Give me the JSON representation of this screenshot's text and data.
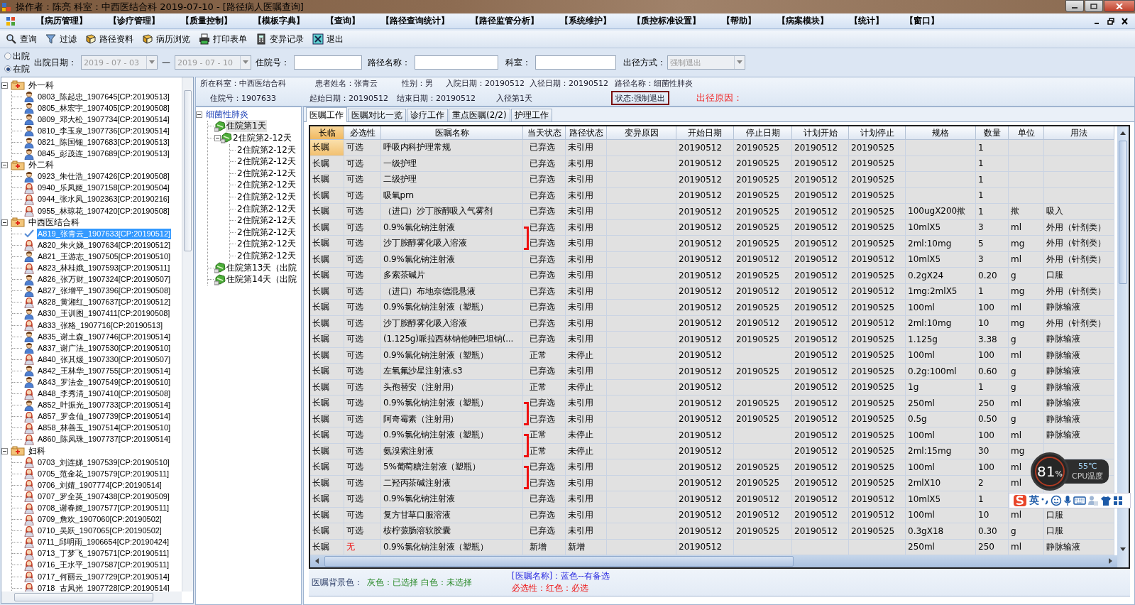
{
  "window": {
    "title": "操作者：陈亮  科室：中西医结合科  2019-07-10 - [路径病人医嘱查询]"
  },
  "menu": [
    "【病历管理】",
    "【诊疗管理】",
    "【质量控制】",
    "【模板字典】",
    "【查询】",
    "【路径查询统计】",
    "【路径监管分析】",
    "【系统维护】",
    "【质控标准设置】",
    "【帮助】",
    "【病案模块】",
    "【统计】",
    "【窗口】"
  ],
  "toolbar": [
    {
      "label": "查询",
      "kind": "search"
    },
    {
      "label": "过滤",
      "kind": "filter"
    },
    {
      "label": "路径资料",
      "kind": "book"
    },
    {
      "label": "病历浏览",
      "kind": "book"
    },
    {
      "label": "打印表单",
      "kind": "print"
    },
    {
      "label": "变异记录",
      "kind": "calc"
    },
    {
      "label": "退出",
      "kind": "exit"
    }
  ],
  "filter": {
    "status_options": [
      {
        "label": "出院",
        "selected": false
      },
      {
        "label": "在院",
        "selected": true
      }
    ],
    "discharge_date": {
      "label": "出院日期：",
      "from": "2019 - 07 - 03",
      "separator": "—",
      "to": "2019 - 07 - 10",
      "disabled": true
    },
    "inputs": [
      {
        "label": "住院号："
      },
      {
        "label": "路径名称："
      },
      {
        "label": "科室："
      }
    ],
    "exit_mode": {
      "label": "出径方式：",
      "value": "强制退出",
      "disabled": true
    }
  },
  "patient_tree": [
    {
      "label": "外一科",
      "expanded": true,
      "children": [
        {
          "label": "0803_陈起忠_1907645[CP:20190513]",
          "kind": "male",
          "selected": false
        },
        {
          "label": "0805_林宏宇_1907405[CP:20190508]",
          "kind": "male",
          "selected": false
        },
        {
          "label": "0809_邓大松_1907734[CP:20190514]",
          "kind": "male",
          "selected": false
        },
        {
          "label": "0810_李玉泉_1907736[CP:20190514]",
          "kind": "male",
          "selected": false
        },
        {
          "label": "0821_陈国钿_1907683[CP:20190513]",
          "kind": "male",
          "selected": false
        },
        {
          "label": "0845_彭茂连_1907689[CP:20190513]",
          "kind": "male",
          "selected": false
        }
      ]
    },
    {
      "label": "外二科",
      "expanded": true,
      "children": [
        {
          "label": "0923_朱仕浩_1907426[CP:20190508]",
          "kind": "male",
          "selected": false
        },
        {
          "label": "0940_乐凤姬_1907158[CP:20190504]",
          "kind": "female",
          "selected": false
        },
        {
          "label": "0944_张水凤_1902363[CP:20190216]",
          "kind": "female",
          "selected": false
        },
        {
          "label": "0955_林琼花_1907420[CP:20190508]",
          "kind": "female",
          "selected": false
        }
      ]
    },
    {
      "label": "中西医结合科",
      "expanded": true,
      "children": [
        {
          "label": "A819_张青云_1907633[CP:20190512]",
          "kind": "check",
          "selected": true
        },
        {
          "label": "A820_朱火娣_1907634[CP:20190512]",
          "kind": "female",
          "selected": false
        },
        {
          "label": "A821_王游志_1907505[CP:20190510]",
          "kind": "male",
          "selected": false
        },
        {
          "label": "A823_林桂娥_1907593[CP:20190511]",
          "kind": "female",
          "selected": false
        },
        {
          "label": "A826_张万财_1907324[CP:20190507]",
          "kind": "male",
          "selected": false
        },
        {
          "label": "A827_张增平_1907396[CP:20190508]",
          "kind": "male",
          "selected": false
        },
        {
          "label": "A828_黄湘红_1907637[CP:20190512]",
          "kind": "female",
          "selected": false
        },
        {
          "label": "A830_王训图_1907411[CP:20190508]",
          "kind": "male",
          "selected": false
        },
        {
          "label": "A833_张格_1907716[CP:20190513]",
          "kind": "female",
          "selected": false
        },
        {
          "label": "A835_谢土森_1907746[CP:20190514]",
          "kind": "male",
          "selected": false
        },
        {
          "label": "A837_谢广法_1907530[CP:20190510]",
          "kind": "male",
          "selected": false
        },
        {
          "label": "A840_张其煖_1907330[CP:20190507]",
          "kind": "female",
          "selected": false
        },
        {
          "label": "A842_王林华_1907755[CP:20190514]",
          "kind": "male",
          "selected": false
        },
        {
          "label": "A843_罗法金_1907549[CP:20190510]",
          "kind": "male",
          "selected": false
        },
        {
          "label": "A848_李秀清_1907410[CP:20190508]",
          "kind": "female",
          "selected": false
        },
        {
          "label": "A852_叶振光_1907733[CP:20190514]",
          "kind": "male",
          "selected": false
        },
        {
          "label": "A857_罗金仙_1907739[CP:20190514]",
          "kind": "female",
          "selected": false
        },
        {
          "label": "A858_林善玉_1907514[CP:20190510]",
          "kind": "female",
          "selected": false
        },
        {
          "label": "A860_陈凤珠_1907737[CP:20190514]",
          "kind": "female",
          "selected": false
        }
      ]
    },
    {
      "label": "妇科",
      "expanded": true,
      "children": [
        {
          "label": "0703_刘连娣_1907539[CP:20190510]",
          "kind": "female",
          "selected": false
        },
        {
          "label": "0705_范金花_1907579[CP:20190511]",
          "kind": "female",
          "selected": false
        },
        {
          "label": "0706_刘婧_1907774[CP:20190514]",
          "kind": "female",
          "selected": false
        },
        {
          "label": "0707_罗全英_1907438[CP:20190509]",
          "kind": "female",
          "selected": false
        },
        {
          "label": "0708_谢春姬_1907577[CP:20190511]",
          "kind": "female",
          "selected": false
        },
        {
          "label": "0709_詹欢_1907060[CP:20190502]",
          "kind": "female",
          "selected": false
        },
        {
          "label": "0710_吴跃_1907065[CP:20190502]",
          "kind": "female",
          "selected": false
        },
        {
          "label": "0711_邱明雨_1906654[CP:20190424]",
          "kind": "female",
          "selected": false
        },
        {
          "label": "0713_丁梦飞_1907571[CP:20190511]",
          "kind": "female",
          "selected": false
        },
        {
          "label": "0716_王水平_1907587[CP:20190511]",
          "kind": "female",
          "selected": false
        },
        {
          "label": "0717_何丽云_1907729[CP:20190514]",
          "kind": "female",
          "selected": false
        },
        {
          "label": "0718_古凤光_1907728[CP:20190514]",
          "kind": "female",
          "selected": false
        }
      ]
    }
  ],
  "info": {
    "rows": [
      [
        "所在科室：中西医结合科",
        "患者姓名：张青云",
        "性别：男",
        "入院日期：20190512",
        "入径日期：20190512",
        "路径名称：细菌性肺炎"
      ],
      [
        "住院号：1907633",
        "起始日期：20190512",
        "结束日期：20190512",
        "入径第1天"
      ]
    ],
    "status": "状态:强制退出",
    "exit_reason_label": "出径原因："
  },
  "path_tree": {
    "label": "细菌性肺炎",
    "expanded": true,
    "selected": false,
    "children": [
      {
        "label": "住院第1天",
        "selected": true
      },
      {
        "label": "2住院第2-12天",
        "expanded": true,
        "selected": false,
        "children": [
          {
            "label": "2住院第2-12天",
            "selected": false
          },
          {
            "label": "2住院第2-12天",
            "selected": false
          },
          {
            "label": "2住院第2-12天",
            "selected": false
          },
          {
            "label": "2住院第2-12天",
            "selected": false
          },
          {
            "label": "2住院第2-12天",
            "selected": false
          },
          {
            "label": "2住院第2-12天",
            "selected": false
          },
          {
            "label": "2住院第2-12天",
            "selected": false
          },
          {
            "label": "2住院第2-12天",
            "selected": false
          },
          {
            "label": "2住院第2-12天",
            "selected": false
          },
          {
            "label": "2住院第2-12天",
            "selected": false
          }
        ]
      },
      {
        "label": "住院第13天（出院",
        "selected": false
      },
      {
        "label": "住院第14天（出院",
        "selected": false
      }
    ]
  },
  "tabs": [
    {
      "label": "医嘱工作",
      "selected": true
    },
    {
      "label": "医嘱对比一览",
      "selected": false
    },
    {
      "label": "诊疗工作",
      "selected": false
    },
    {
      "label": "重点医嘱(2/2)",
      "selected": false
    },
    {
      "label": "护理工作",
      "selected": false
    }
  ],
  "table": {
    "columns": [
      "长临",
      "必选性",
      "医嘱名称",
      "当天状态",
      "路径状态",
      "变异原因",
      "开始日期",
      "停止日期",
      "计划开始",
      "计划停止",
      "规格",
      "数量",
      "单位",
      "用法"
    ],
    "rows": [
      {
        "order_type": "长嘱",
        "required": "可选",
        "name": "呼吸内科护理常规",
        "day_status": "已弃选",
        "path_status": "未引用",
        "start_date": "20190512",
        "stop_date": "20190525",
        "plan_start": "20190512",
        "plan_stop": "20190525",
        "quantity": "1",
        "selected": true,
        "mandatory": false,
        "chosen": true,
        "bracket": false
      },
      {
        "order_type": "长嘱",
        "required": "可选",
        "name": "一级护理",
        "day_status": "已弃选",
        "path_status": "未引用",
        "start_date": "20190512",
        "stop_date": "20190525",
        "plan_start": "20190512",
        "plan_stop": "20190525",
        "quantity": "1",
        "selected": false,
        "mandatory": false,
        "chosen": true,
        "bracket": false
      },
      {
        "order_type": "长嘱",
        "required": "可选",
        "name": "二级护理",
        "day_status": "已弃选",
        "path_status": "未引用",
        "start_date": "20190512",
        "stop_date": "20190525",
        "plan_start": "20190512",
        "plan_stop": "20190525",
        "quantity": "1",
        "selected": false,
        "mandatory": false,
        "chosen": true,
        "bracket": false
      },
      {
        "order_type": "长嘱",
        "required": "可选",
        "name": "吸氧prn",
        "day_status": "已弃选",
        "path_status": "未引用",
        "start_date": "20190512",
        "stop_date": "20190525",
        "plan_start": "20190512",
        "plan_stop": "20190525",
        "quantity": "1",
        "selected": false,
        "mandatory": false,
        "chosen": true,
        "bracket": false
      },
      {
        "order_type": "长嘱",
        "required": "可选",
        "name": "（进口）沙丁胺醇吸入气雾剂",
        "day_status": "已弃选",
        "path_status": "未引用",
        "start_date": "20190512",
        "stop_date": "20190525",
        "plan_start": "20190512",
        "plan_stop": "20190525",
        "spec": "100ugX200揿",
        "quantity": "1",
        "unit": "揿",
        "usage": "吸入",
        "selected": false,
        "mandatory": false,
        "chosen": true,
        "bracket": false
      },
      {
        "order_type": "长嘱",
        "required": "可选",
        "name": "0.9%氯化钠注射液",
        "day_status": "已弃选",
        "path_status": "未引用",
        "start_date": "20190512",
        "stop_date": "20190525",
        "plan_start": "20190512",
        "plan_stop": "20190525",
        "spec": "10mlX5",
        "quantity": "3",
        "unit": "ml",
        "usage": "外用（针剂类）",
        "selected": false,
        "mandatory": false,
        "chosen": true,
        "bracket": true
      },
      {
        "order_type": "长嘱",
        "required": "可选",
        "name": "沙丁胺醇雾化吸入溶液",
        "day_status": "已弃选",
        "path_status": "未引用",
        "start_date": "20190512",
        "stop_date": "20190525",
        "plan_start": "20190512",
        "plan_stop": "20190525",
        "spec": "2ml:10mg",
        "quantity": "5",
        "unit": "mg",
        "usage": "外用（针剂类）",
        "selected": false,
        "mandatory": false,
        "chosen": true,
        "bracket": false
      },
      {
        "order_type": "长嘱",
        "required": "可选",
        "name": "0.9%氯化钠注射液",
        "day_status": "已弃选",
        "path_status": "未引用",
        "start_date": "20190512",
        "stop_date": "20190512",
        "plan_start": "20190512",
        "plan_stop": "20190512",
        "spec": "10mlX5",
        "quantity": "3",
        "unit": "ml",
        "usage": "外用（针剂类）",
        "selected": false,
        "mandatory": false,
        "chosen": true,
        "bracket": false
      },
      {
        "order_type": "长嘱",
        "required": "可选",
        "name": "多索茶碱片",
        "day_status": "已弃选",
        "path_status": "未引用",
        "start_date": "20190512",
        "stop_date": "20190525",
        "plan_start": "20190512",
        "plan_stop": "20190525",
        "spec": "0.2gX24",
        "quantity": "0.20",
        "unit": "g",
        "usage": "口服",
        "selected": false,
        "mandatory": false,
        "chosen": true,
        "bracket": false
      },
      {
        "order_type": "长嘱",
        "required": "可选",
        "name": "（进口）布地奈德混悬液",
        "day_status": "已弃选",
        "path_status": "未引用",
        "start_date": "20190512",
        "stop_date": "20190512",
        "plan_start": "20190512",
        "plan_stop": "20190512",
        "spec": "1mg:2mlX5",
        "quantity": "1",
        "unit": "mg",
        "usage": "外用（针剂类）",
        "selected": false,
        "mandatory": false,
        "chosen": true,
        "bracket": false
      },
      {
        "order_type": "长嘱",
        "required": "可选",
        "name": "0.9%氯化钠注射液（塑瓶）",
        "day_status": "已弃选",
        "path_status": "未引用",
        "start_date": "20190512",
        "stop_date": "20190525",
        "plan_start": "20190512",
        "plan_stop": "20190525",
        "spec": "100ml",
        "quantity": "100",
        "unit": "ml",
        "usage": "静脉输液",
        "selected": false,
        "mandatory": false,
        "chosen": true,
        "bracket": false
      },
      {
        "order_type": "长嘱",
        "required": "可选",
        "name": "沙丁胺醇雾化吸入溶液",
        "day_status": "已弃选",
        "path_status": "未引用",
        "start_date": "20190512",
        "stop_date": "20190512",
        "plan_start": "20190512",
        "plan_stop": "20190512",
        "spec": "2ml:10mg",
        "quantity": "10",
        "unit": "mg",
        "usage": "外用（针剂类）",
        "selected": false,
        "mandatory": false,
        "chosen": true,
        "bracket": false
      },
      {
        "order_type": "长嘱",
        "required": "可选",
        "name": "(1.125g)哌拉西林钠他唑巴坦钠(...",
        "day_status": "已弃选",
        "path_status": "未引用",
        "start_date": "20190512",
        "stop_date": "20190525",
        "plan_start": "20190512",
        "plan_stop": "20190525",
        "spec": "1.125g",
        "quantity": "3.38",
        "unit": "g",
        "usage": "静脉输液",
        "selected": false,
        "mandatory": false,
        "chosen": true,
        "bracket": false
      },
      {
        "order_type": "长嘱",
        "required": "可选",
        "name": "0.9%氯化钠注射液（塑瓶）",
        "day_status": "正常",
        "path_status": "未停止",
        "start_date": "20190512",
        "plan_start": "20190512",
        "plan_stop": "20190525",
        "spec": "100ml",
        "quantity": "100",
        "unit": "ml",
        "usage": "静脉输液",
        "selected": false,
        "mandatory": false,
        "chosen": true,
        "bracket": false
      },
      {
        "order_type": "长嘱",
        "required": "可选",
        "name": "左氧氟沙星注射液.s3",
        "day_status": "已弃选",
        "path_status": "未引用",
        "start_date": "20190512",
        "stop_date": "20190525",
        "plan_start": "20190512",
        "plan_stop": "20190525",
        "spec": "0.2g:100ml",
        "quantity": "0.60",
        "unit": "g",
        "usage": "静脉输液",
        "selected": false,
        "mandatory": false,
        "chosen": true,
        "bracket": false
      },
      {
        "order_type": "长嘱",
        "required": "可选",
        "name": "头孢替安（注射用）",
        "day_status": "正常",
        "path_status": "未停止",
        "start_date": "20190512",
        "plan_start": "20190512",
        "plan_stop": "20190525",
        "spec": "1g",
        "quantity": "1",
        "unit": "g",
        "usage": "静脉输液",
        "selected": false,
        "mandatory": false,
        "chosen": true,
        "bracket": false
      },
      {
        "order_type": "长嘱",
        "required": "可选",
        "name": "0.9%氯化钠注射液（塑瓶）",
        "day_status": "已弃选",
        "path_status": "未引用",
        "start_date": "20190512",
        "stop_date": "20190525",
        "plan_start": "20190512",
        "plan_stop": "20190525",
        "spec": "250ml",
        "quantity": "250",
        "unit": "ml",
        "usage": "静脉输液",
        "selected": false,
        "mandatory": false,
        "chosen": true,
        "bracket": true
      },
      {
        "order_type": "长嘱",
        "required": "可选",
        "name": "阿奇霉素（注射用）",
        "day_status": "已弃选",
        "path_status": "未引用",
        "start_date": "20190512",
        "stop_date": "20190525",
        "plan_start": "20190512",
        "plan_stop": "20190525",
        "spec": "0.5g",
        "quantity": "0.50",
        "unit": "g",
        "usage": "静脉输液",
        "selected": false,
        "mandatory": false,
        "chosen": true,
        "bracket": false
      },
      {
        "order_type": "长嘱",
        "required": "可选",
        "name": "0.9%氯化钠注射液（塑瓶）",
        "day_status": "正常",
        "path_status": "未停止",
        "start_date": "20190512",
        "plan_start": "20190512",
        "plan_stop": "20190525",
        "spec": "100ml",
        "quantity": "100",
        "unit": "ml",
        "usage": "静脉输液",
        "selected": false,
        "mandatory": false,
        "chosen": true,
        "bracket": true
      },
      {
        "order_type": "长嘱",
        "required": "可选",
        "name": "氨溴索注射液",
        "day_status": "正常",
        "path_status": "未停止",
        "start_date": "20190512",
        "plan_start": "20190512",
        "plan_stop": "20190525",
        "spec": "2ml:15mg",
        "quantity": "30",
        "unit": "mg",
        "selected": false,
        "mandatory": false,
        "chosen": true,
        "bracket": false
      },
      {
        "order_type": "长嘱",
        "required": "可选",
        "name": "5%葡萄糖注射液（塑瓶）",
        "day_status": "已弃选",
        "path_status": "未引用",
        "start_date": "20190512",
        "stop_date": "20190525",
        "plan_start": "20190512",
        "plan_stop": "20190525",
        "spec": "100ml",
        "quantity": "100",
        "unit": "ml",
        "selected": false,
        "mandatory": false,
        "chosen": true,
        "bracket": true
      },
      {
        "order_type": "长嘱",
        "required": "可选",
        "name": "二羟丙茶碱注射液",
        "day_status": "已弃选",
        "path_status": "未引用",
        "start_date": "20190512",
        "stop_date": "20190525",
        "plan_start": "20190512",
        "plan_stop": "20190525",
        "spec": "2mlX10",
        "quantity": "2",
        "unit": "ml",
        "selected": false,
        "mandatory": false,
        "chosen": true,
        "bracket": false
      },
      {
        "order_type": "长嘱",
        "required": "可选",
        "name": "0.9%氯化钠注射液",
        "day_status": "已弃选",
        "path_status": "未引用",
        "start_date": "20190512",
        "stop_date": "20190512",
        "plan_start": "20190512",
        "plan_stop": "20190512",
        "spec": "10mlX5",
        "quantity": "1",
        "selected": false,
        "mandatory": false,
        "chosen": true,
        "bracket": false
      },
      {
        "order_type": "长嘱",
        "required": "可选",
        "name": "复方甘草口服溶液",
        "day_status": "已弃选",
        "path_status": "未引用",
        "start_date": "20190512",
        "stop_date": "20190512",
        "plan_start": "20190512",
        "plan_stop": "20190512",
        "spec": "100ml",
        "quantity": "10",
        "unit": "ml",
        "usage": "口服",
        "selected": false,
        "mandatory": false,
        "chosen": true,
        "bracket": false
      },
      {
        "order_type": "长嘱",
        "required": "可选",
        "name": "桉柠蒎肠溶软胶囊",
        "day_status": "已弃选",
        "path_status": "未引用",
        "start_date": "20190512",
        "stop_date": "20190525",
        "plan_start": "20190512",
        "plan_stop": "20190525",
        "spec": "0.3gX18",
        "quantity": "0.30",
        "unit": "g",
        "usage": "口服",
        "selected": false,
        "mandatory": false,
        "chosen": true,
        "bracket": false
      },
      {
        "order_type": "长嘱",
        "required": "无",
        "name": "0.9%氯化钠注射液（塑瓶）",
        "day_status": "新增",
        "path_status": "新增",
        "start_date": "20190512",
        "spec": "250ml",
        "quantity": "250",
        "unit": "ml",
        "usage": "静脉输液",
        "selected": false,
        "mandatory": true,
        "chosen": true,
        "bracket": false
      }
    ]
  },
  "legend": {
    "title": "医嘱背景色：",
    "background_note": "灰色：已选择 白色：未选择",
    "name_note": "[医嘱名称]：蓝色--有备选",
    "required_note": "必选性：红色：必选"
  },
  "cpu_widget": {
    "usage": "81",
    "unit": "%",
    "temperature": "55℃",
    "label": "CPU温度"
  },
  "ime_bar": {
    "mode": "英"
  }
}
